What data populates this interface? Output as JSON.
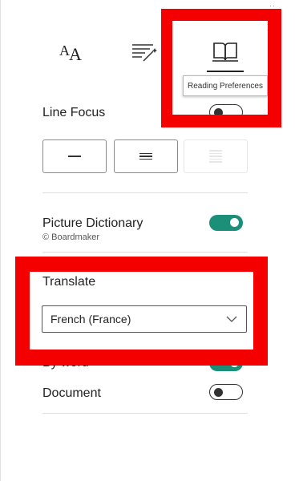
{
  "panel": {
    "top_marks": "··",
    "close_glyph": "×"
  },
  "tabs": [
    {
      "id": "text-options",
      "icon": "text-size-icon"
    },
    {
      "id": "grammar-options",
      "icon": "grammar-wand-icon"
    },
    {
      "id": "reading-preferences",
      "icon": "open-book-icon",
      "selected": true
    }
  ],
  "tooltip": {
    "text": "Reading Preferences"
  },
  "line_focus": {
    "label": "Line Focus",
    "toggle_on": false,
    "options": [
      {
        "icon": "single-line-icon",
        "enabled": true
      },
      {
        "icon": "three-lines-icon",
        "enabled": true
      },
      {
        "icon": "five-lines-icon",
        "enabled": false
      }
    ]
  },
  "picture_dictionary": {
    "label": "Picture Dictionary",
    "credit": "© Boardmaker",
    "toggle_on": true
  },
  "translate": {
    "label": "Translate",
    "selected_language": "French (France)",
    "by_word_label": "By word",
    "by_word_on": true,
    "document_label": "Document",
    "document_on": false
  },
  "colors": {
    "accent_green": "#1b8f78",
    "highlight_red": "#f40000"
  }
}
